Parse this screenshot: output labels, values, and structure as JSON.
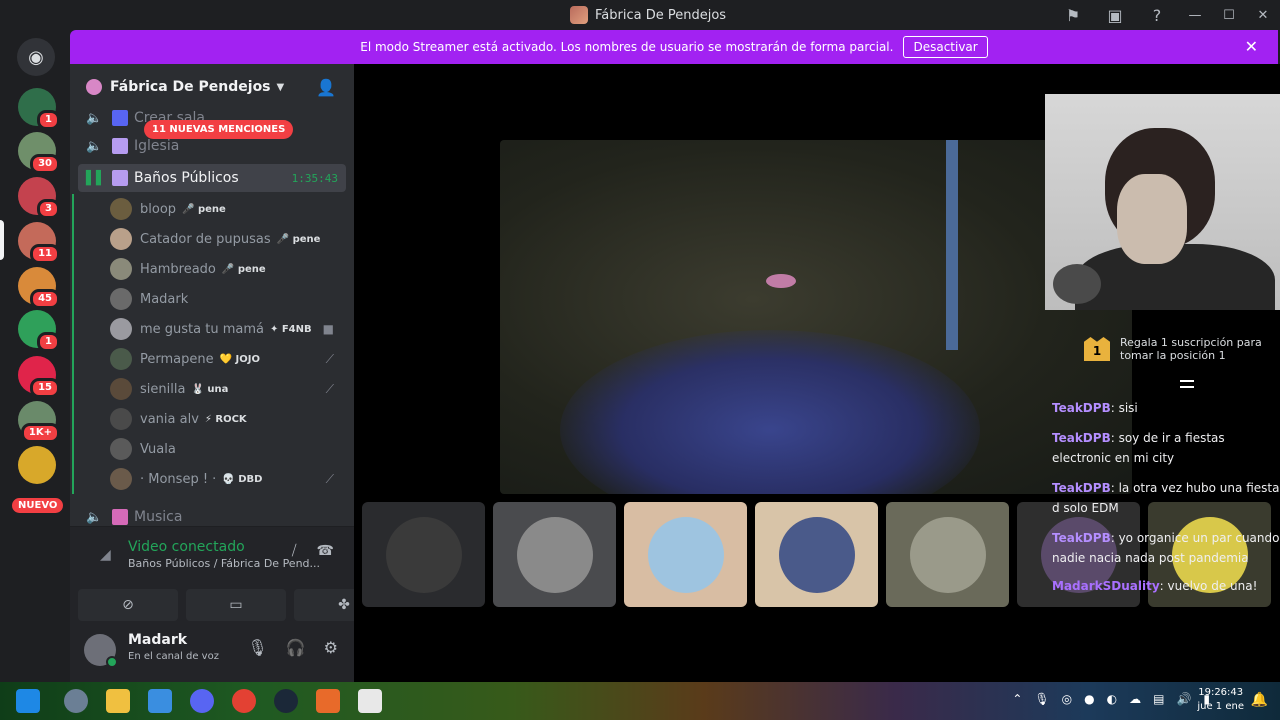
{
  "window": {
    "title": "Fábrica De Pendejos"
  },
  "banner": {
    "text": "El modo Streamer está activado. Los nombres de usuario se mostrarán de forma parcial.",
    "button": "Desactivar"
  },
  "guilds": [
    {
      "badge": "1",
      "color": "#2f6e4a"
    },
    {
      "badge": "30",
      "color": "#6f8f6a"
    },
    {
      "badge": "3",
      "color": "#c4424e"
    },
    {
      "badge": "11",
      "color": "#c46a5a"
    },
    {
      "badge": "45",
      "color": "#d98a3a"
    },
    {
      "badge": "1",
      "color": "#2fa05a"
    },
    {
      "badge": "15",
      "color": "#e0244a"
    },
    {
      "badge": "1K+",
      "color": "#6a8a6a"
    },
    {
      "badge": "",
      "color": "#d8a82a"
    }
  ],
  "guild_new_label": "NUEVO",
  "server": {
    "name": "Fábrica De Pendejos"
  },
  "mentions_label": "11 NUEVAS MENCIONES",
  "channels": {
    "crear": "Crear sala",
    "iglesia": "Iglesia",
    "banos": "Baños Públicos",
    "banos_timer": "1:35:43",
    "musica": "Musica"
  },
  "voice_users": [
    {
      "name": "bloop",
      "tag": "🎤 pene"
    },
    {
      "name": "Catador de pupusas",
      "tag": "🎤 pene"
    },
    {
      "name": "Hambreado",
      "tag": "🎤 pene"
    },
    {
      "name": "Madark",
      "tag": ""
    },
    {
      "name": "me gusta tu mamá",
      "tag": "✦ F4NB"
    },
    {
      "name": "Permapene",
      "tag": "💛 JOJO"
    },
    {
      "name": "sienilla",
      "tag": "🐰 una"
    },
    {
      "name": "vania alv",
      "tag": "⚡ ROCK"
    },
    {
      "name": "Vuala",
      "tag": ""
    },
    {
      "name": "· Monsep ! ·",
      "tag": "💀 DBD"
    }
  ],
  "rtc": {
    "status": "Video conectado",
    "sub": "Baños Públicos / Fábrica De Pend..."
  },
  "user": {
    "name": "Madark",
    "status": "En el canal de voz"
  },
  "chat": {
    "promo": "Regala 1 suscripción para tomar la posición 1",
    "crown_num": "1",
    "messages": [
      {
        "user": "TeakDPB",
        "text": ": sisi"
      },
      {
        "user": "TeakDPB",
        "text": ": soy de ir a fiestas electronic en mi city"
      },
      {
        "user": "TeakDPB",
        "text": ": la otra vez hubo una fiesta d solo EDM"
      },
      {
        "user": "TeakDPB",
        "text": ": yo organice un par cuando nadie nacia nada post pandemia"
      },
      {
        "user": "MadarkSDuality",
        "text": ": vuelvo de una!"
      }
    ]
  },
  "clock": {
    "time": "19:26:43",
    "date": "jue 1 ene"
  },
  "colors": {
    "accent": "#a222f2",
    "green": "#23a55a",
    "red": "#f23f43"
  }
}
